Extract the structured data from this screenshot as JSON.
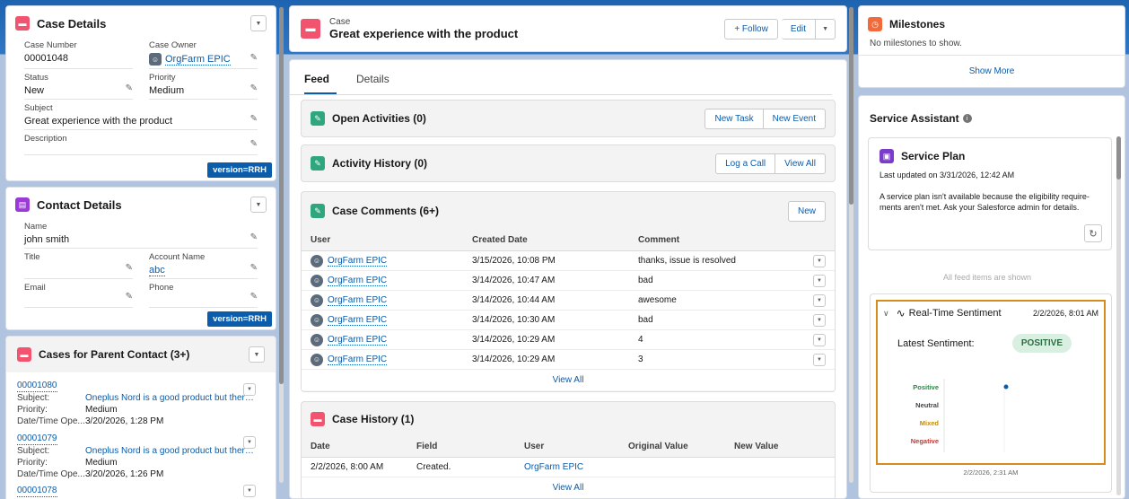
{
  "case_details": {
    "title": "Case Details",
    "case_number_label": "Case Number",
    "case_number": "00001048",
    "case_owner_label": "Case Owner",
    "case_owner": "OrgFarm EPIC",
    "status_label": "Status",
    "status": "New",
    "priority_label": "Priority",
    "priority": "Medium",
    "subject_label": "Subject",
    "subject": "Great experience with the product",
    "description_label": "Description",
    "version": "version=RRH"
  },
  "contact_details": {
    "title": "Contact Details",
    "name_label": "Name",
    "name": "john smith",
    "title_label": "Title",
    "account_label": "Account Name",
    "account": "abc",
    "email_label": "Email",
    "phone_label": "Phone",
    "version": "version=RRH"
  },
  "parent_cases": {
    "title": "Cases for Parent Contact (3+)",
    "subject_label": "Subject:",
    "priority_label": "Priority:",
    "datetime_label": "Date/Time Ope...",
    "items": [
      {
        "number": "00001080",
        "subject": "Oneplus Nord is a good product but there i...",
        "priority": "Medium",
        "datetime": "3/20/2026, 1:28 PM"
      },
      {
        "number": "00001079",
        "subject": "Oneplus Nord is a good product but there i...",
        "priority": "Medium",
        "datetime": "3/20/2026, 1:26 PM"
      }
    ],
    "partial_number": "00001078"
  },
  "header": {
    "object_label": "Case",
    "title": "Great experience with the product",
    "follow_label": "+ Follow",
    "edit_label": "Edit"
  },
  "tabs": {
    "feed": "Feed",
    "details": "Details"
  },
  "open_activities": {
    "title": "Open Activities (0)",
    "new_task": "New Task",
    "new_event": "New Event"
  },
  "activity_history": {
    "title": "Activity History (0)",
    "log_call": "Log a Call",
    "view_all": "View All"
  },
  "case_comments": {
    "title": "Case Comments (6+)",
    "new_label": "New",
    "columns": [
      "User",
      "Created Date",
      "Comment"
    ],
    "rows": [
      {
        "user": "OrgFarm EPIC",
        "date": "3/15/2026, 10:08 PM",
        "comment": "thanks, issue is resolved"
      },
      {
        "user": "OrgFarm EPIC",
        "date": "3/14/2026, 10:47 AM",
        "comment": "bad"
      },
      {
        "user": "OrgFarm EPIC",
        "date": "3/14/2026, 10:44 AM",
        "comment": "awesome"
      },
      {
        "user": "OrgFarm EPIC",
        "date": "3/14/2026, 10:30 AM",
        "comment": "bad"
      },
      {
        "user": "OrgFarm EPIC",
        "date": "3/14/2026, 10:29 AM",
        "comment": "4"
      },
      {
        "user": "OrgFarm EPIC",
        "date": "3/14/2026, 10:29 AM",
        "comment": "3"
      }
    ],
    "view_all": "View All"
  },
  "case_history": {
    "title": "Case History (1)",
    "columns": [
      "Date",
      "Field",
      "User",
      "Original Value",
      "New Value"
    ],
    "rows": [
      {
        "date": "2/2/2026, 8:00 AM",
        "field": "Created.",
        "user": "OrgFarm EPIC",
        "original": "",
        "new": ""
      }
    ],
    "view_all": "View All"
  },
  "milestones": {
    "title": "Milestones",
    "empty": "No milestones to show.",
    "show_more": "Show More"
  },
  "service_assistant": {
    "title": "Service Assistant",
    "plan_title": "Service Plan",
    "plan_updated": "Last updated on 3/31/2026, 12:42 AM",
    "plan_message": "A service plan isn't available because the eligibility require-ments aren't met. Ask your Salesforce admin for details.",
    "feed_note": "All feed items are shown"
  },
  "sentiment": {
    "title": "Real-Time Sentiment",
    "date": "2/2/2026, 8:01 AM",
    "latest_label": "Latest Sentiment:",
    "latest_value": "POSITIVE",
    "chart_date": "2/2/2026, 2:31 AM"
  },
  "chart_data": {
    "type": "scatter",
    "categories": [
      "Positive",
      "Neutral",
      "Mixed",
      "Negative"
    ],
    "category_colors": [
      "#2e844a",
      "#444444",
      "#c68a00",
      "#c23934"
    ],
    "points": [
      {
        "x": "2/2/2026, 2:31 AM",
        "y": "Positive"
      }
    ],
    "xlabel": "2/2/2026, 2:31 AM"
  },
  "colors": {
    "brand_blue": "#0b5cab",
    "case_pink": "#f2536e",
    "contact_purple": "#9b3ad6",
    "activity_green": "#2fa67e",
    "highlight_orange": "#d98c1e"
  }
}
